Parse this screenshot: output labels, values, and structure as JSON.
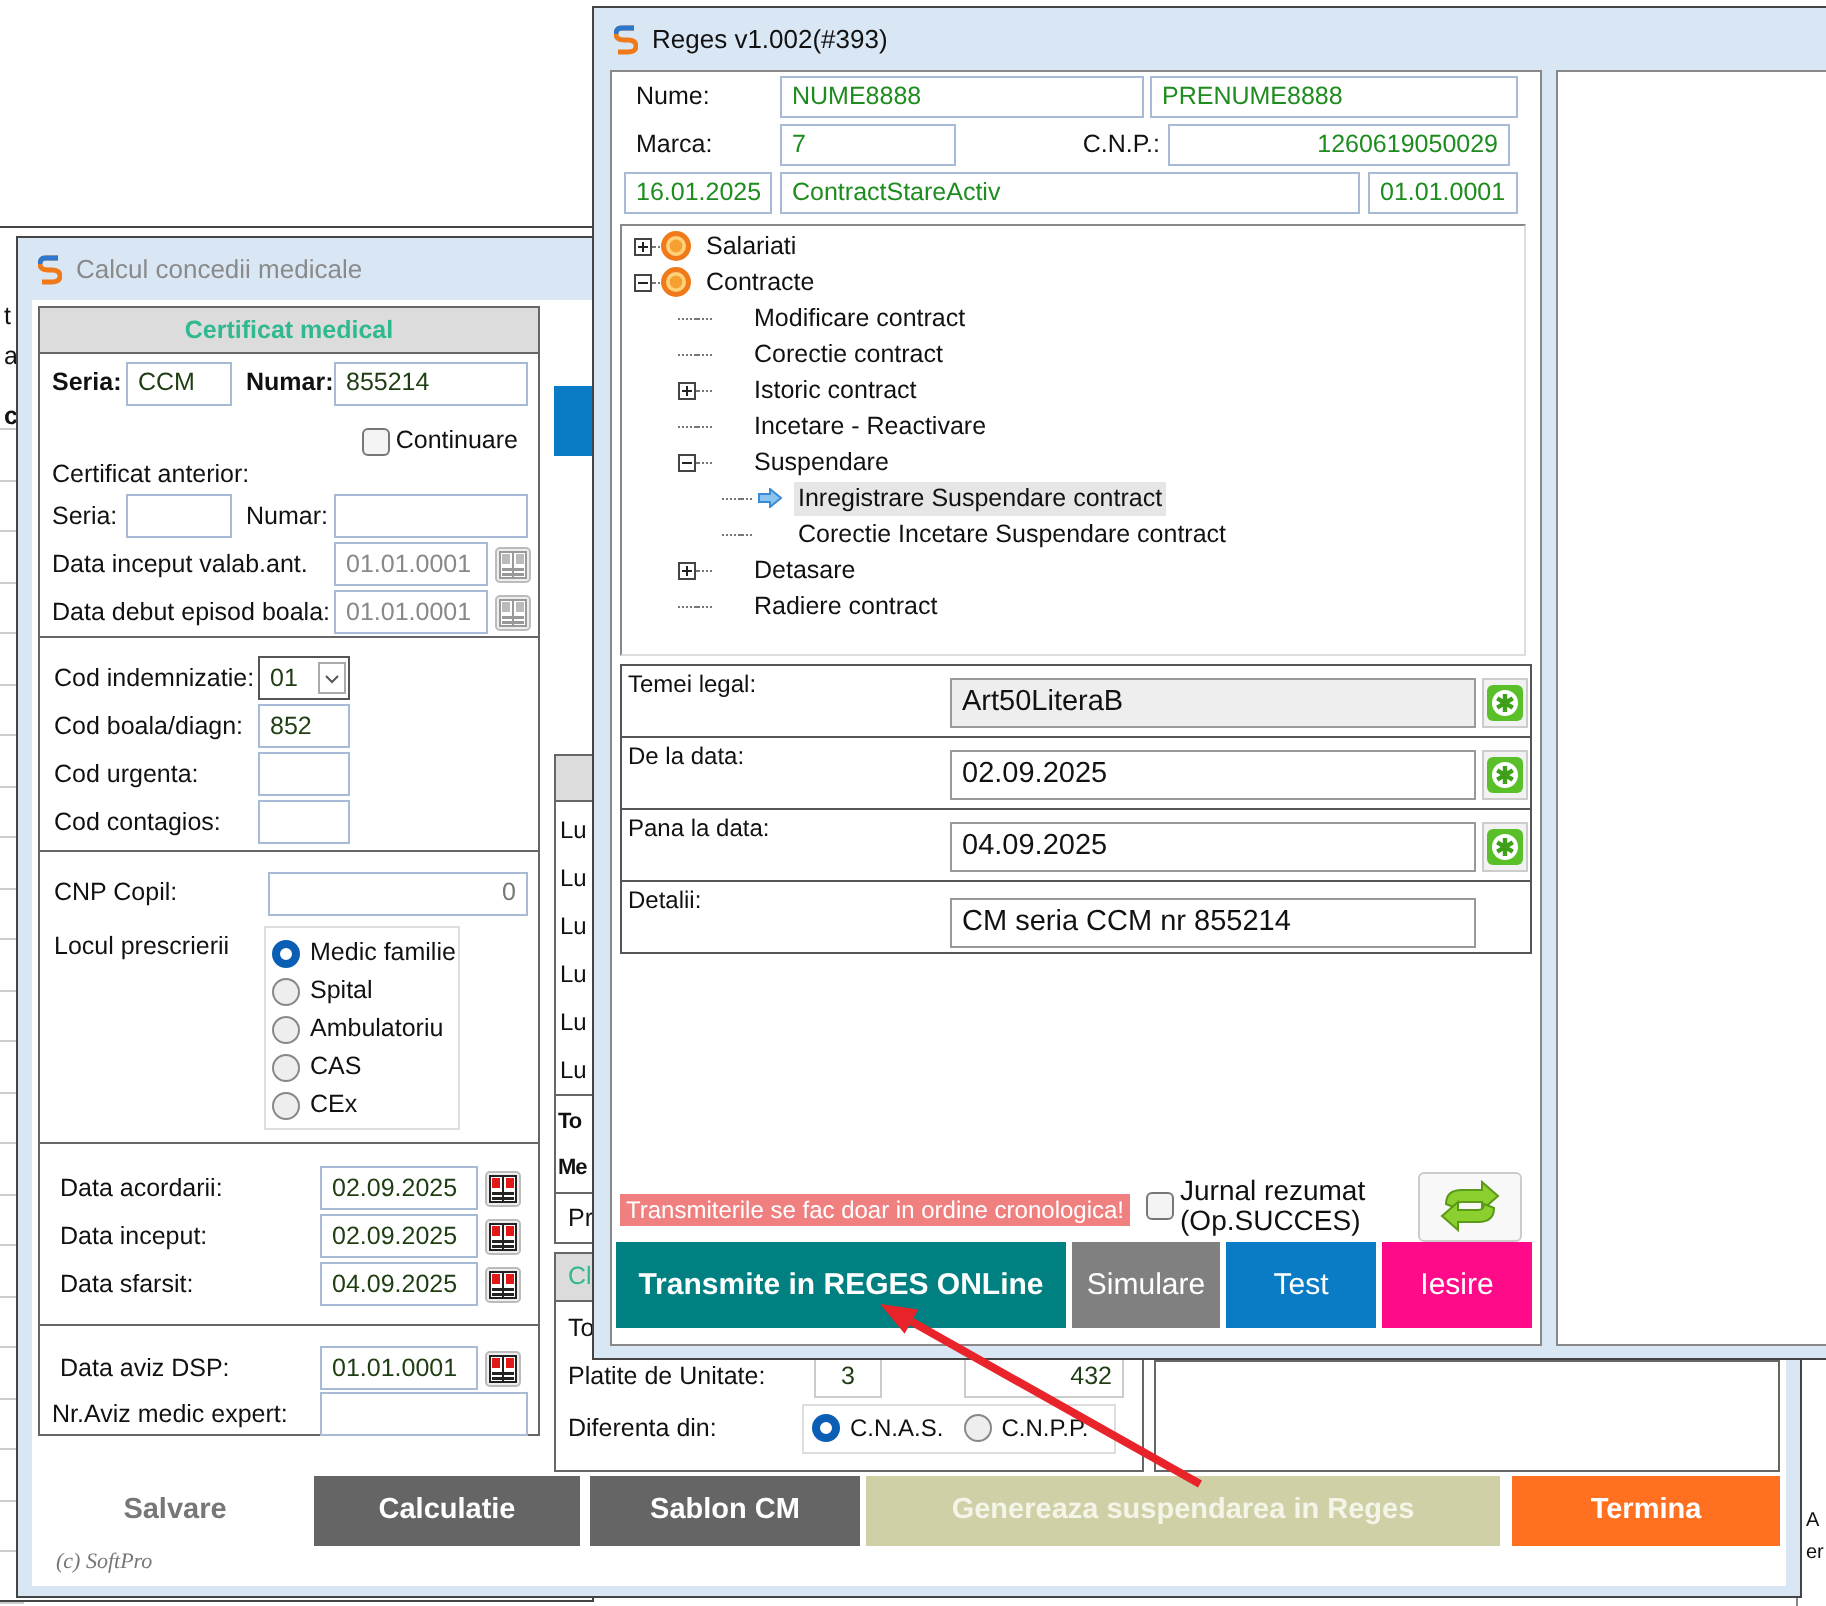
{
  "background_window": {
    "fragments": [
      "t",
      "a",
      "c"
    ]
  },
  "right_background": {
    "fragments": [
      "A",
      "er"
    ]
  },
  "medical_window": {
    "title": "Calcul concedii medicale",
    "certificate": {
      "header": "Certificat medical",
      "series": {
        "label": "Seria:",
        "value": "CCM"
      },
      "number": {
        "label": "Numar:",
        "value": "855214"
      },
      "continuation": {
        "label": "Continuare",
        "checked": false
      },
      "previous_title": "Certificat anterior:",
      "previous_series": {
        "label": "Seria:"
      },
      "previous_number": {
        "label": "Numar:"
      },
      "previous_dates": [
        {
          "label": "Data inceput valab.ant.",
          "value": "01.01.0001",
          "disabled": true
        },
        {
          "label": "Data debut episod boala:",
          "value": "01.01.0001",
          "disabled": true
        }
      ],
      "codes": [
        {
          "kind": "select",
          "label": "Cod indemnizatie:",
          "value": "01"
        },
        {
          "kind": "text",
          "label": "Cod boala/diagn:",
          "value": "852"
        },
        {
          "kind": "text",
          "label": "Cod urgenta:"
        },
        {
          "kind": "text",
          "label": "Cod contagios:"
        }
      ],
      "child_cnp": {
        "label": "CNP Copil:",
        "value": "0"
      },
      "prescription_place": {
        "label": "Locul prescrierii",
        "options": [
          {
            "label": "Medic familie",
            "selected": true
          },
          {
            "label": "Spital",
            "selected": false
          },
          {
            "label": "Ambulatoriu",
            "selected": false
          },
          {
            "label": "CAS",
            "selected": false
          },
          {
            "label": "CEx",
            "selected": false
          }
        ]
      },
      "dates": [
        {
          "label": "Data acordarii:",
          "value": "02.09.2025",
          "disabled": false
        },
        {
          "label": "Data inceput:",
          "value": "02.09.2025",
          "disabled": false
        },
        {
          "label": "Data sfarsit:",
          "value": "04.09.2025",
          "disabled": false
        }
      ],
      "dsp_date": {
        "label": "Data aviz DSP:",
        "value": "01.01.0001",
        "disabled": false
      },
      "expert_notice": {
        "label": "Nr.Aviz medic expert:"
      }
    },
    "calc_panel": {
      "row_labels": [
        "Lu",
        "Lu",
        "Lu",
        "Lu",
        "Lu",
        "Lu"
      ],
      "total_labels": [
        "To",
        "Me"
      ],
      "row_label": "Pr"
    },
    "cl_panel": {
      "header": "Cl",
      "row_label": "To",
      "paid_by_unit": {
        "label": "Platite de Unitate:",
        "days": "3",
        "amount": "432"
      },
      "difference": {
        "label": "Diferenta din:",
        "options": [
          {
            "label": "C.N.A.S.",
            "selected": true
          },
          {
            "label": "C.N.P.P.",
            "selected": false
          }
        ]
      }
    },
    "buttons": [
      {
        "label": "Salvare",
        "color": "#ffffff",
        "disabled": true
      },
      {
        "label": "Calculatie",
        "color": "#656565",
        "disabled": false
      },
      {
        "label": "Sablon CM",
        "color": "#656565",
        "disabled": false
      },
      {
        "label": "Genereaza suspendarea in Reges",
        "color": "#d0d0a6",
        "disabled": true
      },
      {
        "label": "Termina",
        "color": "#ff7020",
        "disabled": false
      }
    ],
    "copyright": "(c) SoftPro"
  },
  "reges_window": {
    "title": "Reges v1.002(#393)",
    "employee": {
      "name_label": "Nume:",
      "last_name": "NUME8888",
      "first_name": "PRENUME8888",
      "id_label": "Marca:",
      "id": "7",
      "cnp_label": "C.N.P.:",
      "cnp": "1260619050029",
      "contract_date": "16.01.2025",
      "contract_state": "ContractStareActiv",
      "end_date": "01.01.0001"
    },
    "tree": [
      {
        "label": "Salariati",
        "expanded": false,
        "selected": false
      },
      {
        "label": "Contracte",
        "expanded": true,
        "selected": false,
        "children": [
          {
            "label": "Modificare contract",
            "selected": false
          },
          {
            "label": "Corectie contract",
            "selected": false
          },
          {
            "label": "Istoric contract",
            "expanded": false,
            "selected": false
          },
          {
            "label": "Incetare - Reactivare",
            "selected": false
          },
          {
            "label": "Suspendare",
            "expanded": true,
            "selected": false,
            "children": [
              {
                "label": "Inregistrare Suspendare contract",
                "selected": true
              },
              {
                "label": "Corectie Incetare Suspendare contract",
                "selected": false
              }
            ]
          },
          {
            "label": "Detasare",
            "expanded": false,
            "selected": false
          },
          {
            "label": "Radiere contract",
            "selected": false
          }
        ]
      }
    ],
    "form": [
      {
        "kind": "picker",
        "label": "Temei legal:",
        "value": "Art50LiteraB",
        "readonly": true
      },
      {
        "kind": "picker",
        "label": "De la data:",
        "value": "02.09.2025",
        "readonly": false
      },
      {
        "kind": "picker",
        "label": "Pana la data:",
        "value": "04.09.2025",
        "readonly": false
      },
      {
        "kind": "text",
        "label": "Detalii:",
        "value": "CM seria CCM nr 855214",
        "readonly": false
      }
    ],
    "notice": "Transmiterile se fac doar in ordine cronologica!",
    "summary_log": {
      "label": "Jurnal rezumat (Op.SUCCES)",
      "checked": false
    },
    "buttons": [
      {
        "kind": "primary",
        "label": "Transmite in REGES ONLine",
        "color": "#008080"
      },
      {
        "kind": "secondary",
        "label": "Simulare",
        "color": "#808080"
      },
      {
        "kind": "secondary",
        "label": "Test",
        "color": "#0a7cc6"
      },
      {
        "kind": "secondary",
        "label": "Iesire",
        "color": "#ff0a88"
      }
    ]
  }
}
